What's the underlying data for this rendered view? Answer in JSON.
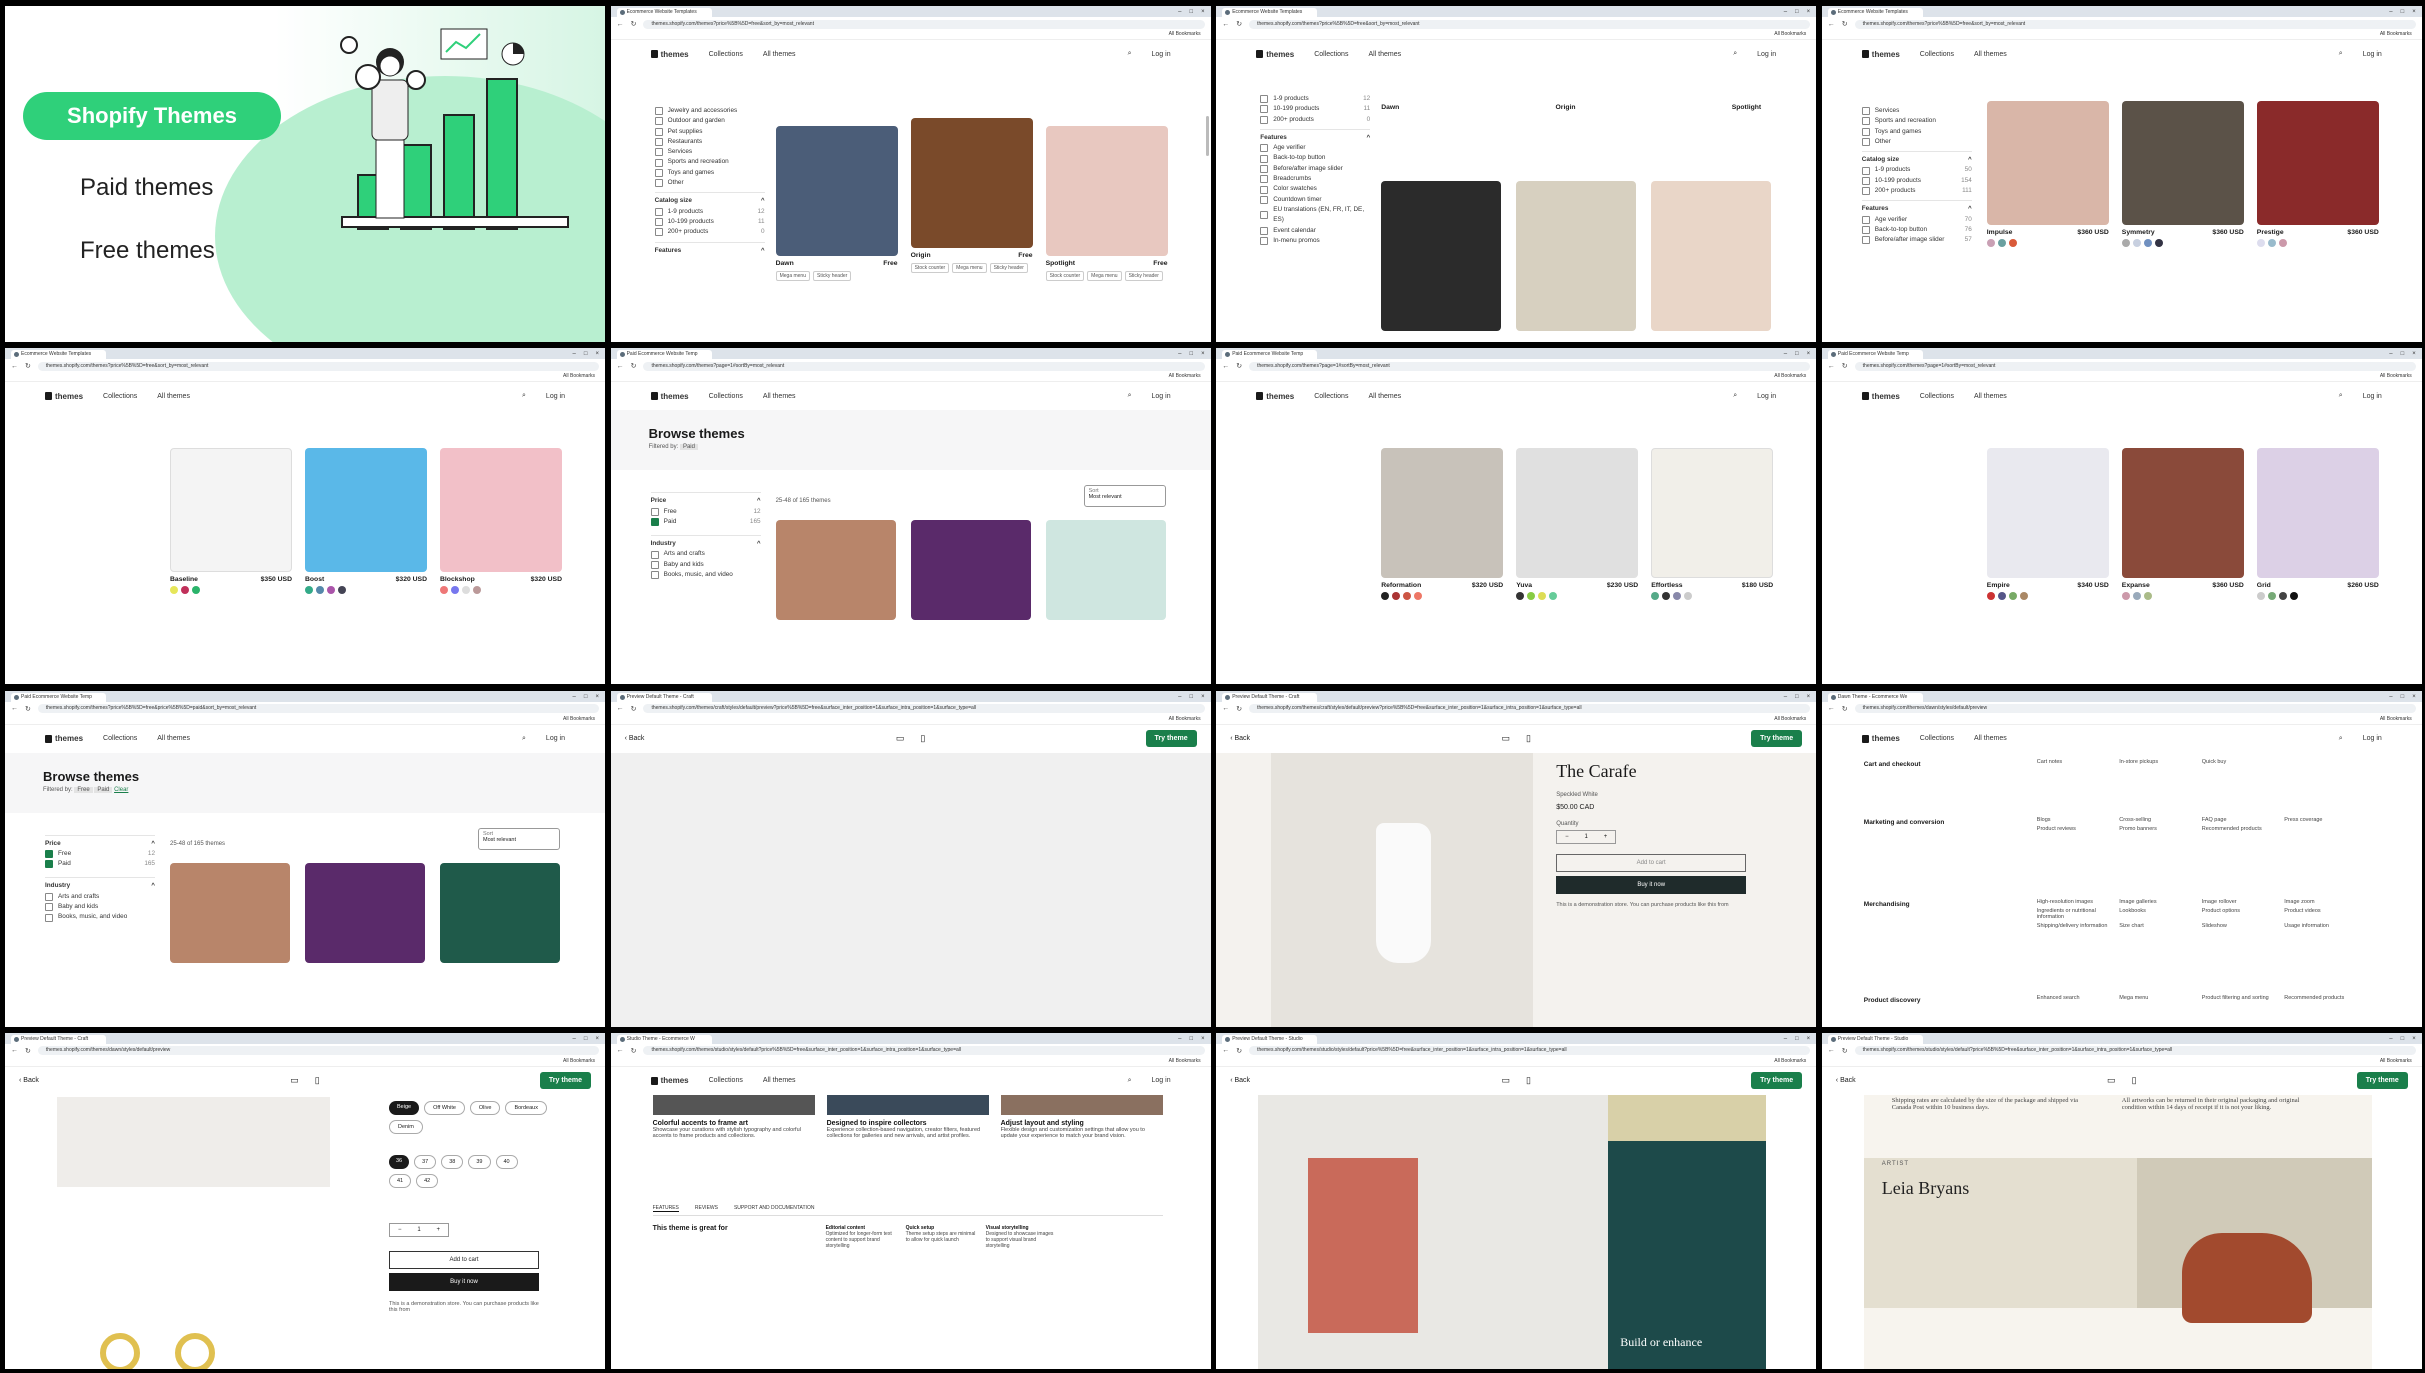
{
  "intro": {
    "badge": "Shopify Themes",
    "paid": "Paid themes",
    "free": "Free themes"
  },
  "browser": {
    "tab_ecom": "Ecommerce Website Templates",
    "tab_paid": "Paid Ecommerce Website Temp",
    "tab_preview": "Preview Default Theme - Craft",
    "tab_dawn": "Dawn Theme - Ecommerce We",
    "tab_studio": "Studio Theme - Ecommerce W",
    "tab_preview_studio": "Preview Default Theme - Studio",
    "url_list": "themes.shopify.com/themes?price%5B%5D=free&sort_by=most_relevant",
    "url_paid": "themes.shopify.com/themes?page=1#sortBy=most_relevant",
    "url_paid2": "themes.shopify.com/themes?price%5B%5D=free&price%5B%5D=paid&sort_by=most_relevant",
    "url_craft": "themes.shopify.com/themes/craft/styles/default/preview?price%5B%5D=free&surface_inter_position=1&surface_intra_position=1&surface_type=all",
    "url_dawn": "themes.shopify.com/themes/dawn/styles/default/preview",
    "url_studio": "themes.shopify.com/themes/studio/styles/default?price%5B%5D=free&surface_inter_position=1&surface_intra_position=1&surface_type=all",
    "bookmarks": "All Bookmarks"
  },
  "store": {
    "logo": "themes",
    "collections": "Collections",
    "all": "All themes",
    "login": "Log in",
    "back": "Back",
    "try": "Try theme"
  },
  "filters": {
    "industry_items": [
      "Jewelry and accessories",
      "Outdoor and garden",
      "Pet supplies",
      "Restaurants",
      "Services",
      "Sports and recreation",
      "Toys and games",
      "Other"
    ],
    "catalog_title": "Catalog size",
    "catalog": [
      {
        "l": "1-9 products",
        "c": "12"
      },
      {
        "l": "10-199 products",
        "c": "11"
      },
      {
        "l": "200+ products",
        "c": "0"
      }
    ],
    "features": "Features",
    "feature_items": [
      "Age verifier",
      "Back-to-top button",
      "Before/after image slider",
      "Breadcrumbs",
      "Color swatches",
      "Countdown timer",
      "EU translations (EN, FR, IT, DE, ES)",
      "Event calendar",
      "In-menu promos"
    ],
    "t4_items": [
      "Services",
      "Sports and recreation",
      "Toys and games",
      "Other"
    ],
    "t4_catalog": [
      {
        "l": "1-9 products",
        "c": "50"
      },
      {
        "l": "10-199 products",
        "c": "154"
      },
      {
        "l": "200+ products",
        "c": "111"
      }
    ],
    "t4_feat": [
      {
        "l": "Age verifier",
        "c": "70"
      },
      {
        "l": "Back-to-top button",
        "c": "76"
      },
      {
        "l": "Before/after image slider",
        "c": "57"
      }
    ],
    "price": "Price",
    "price_items": [
      {
        "l": "Free",
        "c": "12"
      },
      {
        "l": "Paid",
        "c": "165"
      }
    ],
    "industry": "Industry",
    "ind_items": [
      "Arts and crafts",
      "Baby and kids",
      "Books, music, and video"
    ]
  },
  "browse": {
    "title": "Browse themes",
    "filtered": "Filtered by:",
    "paid": "Paid",
    "free": "Free",
    "clear": "Clear",
    "count": "25-48 of 165 themes",
    "sort_label": "Sort",
    "sort": "Most relevant"
  },
  "free_cards": [
    {
      "name": "Dawn",
      "price": "Free",
      "tags": [
        "Mega menu",
        "Sticky header"
      ]
    },
    {
      "name": "Origin",
      "price": "Free",
      "tags": [
        "Stock counter",
        "Mega menu",
        "Sticky header"
      ]
    },
    {
      "name": "Spotlight",
      "price": "Free",
      "tags": [
        "Stock counter",
        "Mega menu",
        "Sticky header"
      ]
    }
  ],
  "paid_cards1": [
    {
      "name": "Impulse",
      "price": "$360 USD"
    },
    {
      "name": "Symmetry",
      "price": "$360 USD"
    },
    {
      "name": "Prestige",
      "price": "$360 USD"
    }
  ],
  "paid_cards2": [
    {
      "name": "Baseline",
      "price": "$350 USD"
    },
    {
      "name": "Boost",
      "price": "$320 USD"
    },
    {
      "name": "Blockshop",
      "price": "$320 USD"
    }
  ],
  "paid_cards3": [
    {
      "name": "Reformation",
      "price": "$320 USD"
    },
    {
      "name": "Yuva",
      "price": "$230 USD"
    },
    {
      "name": "Effortless",
      "price": "$180 USD"
    }
  ],
  "paid_cards4": [
    {
      "name": "Empire",
      "price": "$340 USD"
    },
    {
      "name": "Expanse",
      "price": "$360 USD"
    },
    {
      "name": "Grid",
      "price": "$260 USD"
    }
  ],
  "carafe": {
    "title": "The Carafe",
    "sub": "Speckled White",
    "price": "$50.00 CAD",
    "qty": "Quantity",
    "add": "Add to cart",
    "buy": "Buy it now",
    "note": "This is a demonstration store. You can purchase products like this from"
  },
  "dawn_features": [
    {
      "h": "Cart and checkout",
      "items": [
        "Cart notes",
        "In-store pickups",
        "Quick buy"
      ]
    },
    {
      "h": "Marketing and conversion",
      "items": [
        "Blogs",
        "Cross-selling",
        "FAQ page",
        "Press coverage",
        "Product reviews",
        "Promo banners",
        "Recommended products"
      ]
    },
    {
      "h": "Merchandising",
      "items": [
        "High-resolution images",
        "Image galleries",
        "Image rollover",
        "Image zoom",
        "Ingredients or nutritional information",
        "Lookbooks",
        "Product options",
        "Product videos",
        "Shipping/delivery information",
        "Size chart",
        "Slideshow",
        "Usage information"
      ]
    },
    {
      "h": "Product discovery",
      "items": [
        "Enhanced search",
        "Mega menu",
        "Product filtering and sorting",
        "Recommended products"
      ]
    }
  ],
  "dawn_variant": {
    "colors": [
      "Beige",
      "Off White",
      "Olive",
      "Bordeaux",
      "Denim"
    ],
    "sizes": [
      "36",
      "37",
      "38",
      "39",
      "40",
      "41",
      "42"
    ],
    "add": "Add to cart",
    "buy": "Buy it now",
    "note": "This is a demonstration store. You can purchase products like this from"
  },
  "studio": {
    "cols": [
      {
        "h": "Colorful accents to frame art",
        "t": "Showcase your curations with stylish typography and colorful accents to frame products and collections."
      },
      {
        "h": "Designed to inspire collectors",
        "t": "Experience collection-based navigation, creator filters, featured collections for galleries and new arrivals, and artist profiles."
      },
      {
        "h": "Adjust layout and styling",
        "t": "Flexible design and customization settings that allow you to update your experience to match your brand vision."
      }
    ],
    "tabs": [
      "FEATURES",
      "REVIEWS",
      "SUPPORT AND DOCUMENTATION"
    ],
    "great": "This theme is great for",
    "great_items": [
      {
        "h": "Editorial content",
        "t": "Optimized for longer-form text content to support brand storytelling"
      },
      {
        "h": "Quick setup",
        "t": "Theme setup steps are minimal to allow for quick launch"
      },
      {
        "h": "Visual storytelling",
        "t": "Designed to showcase images to support visual brand storytelling"
      }
    ]
  },
  "studio_preview": {
    "banner": "Build or enhance"
  },
  "artist": {
    "ship": "Shipping rates are calculated by the size of the package and shipped via Canada Post within 10 business days.",
    "ret": "All artworks can be returned in their original packaging and original condition within 14 days of receipt if it is not your liking.",
    "label": "ARTIST",
    "name": "Leia Bryans"
  }
}
